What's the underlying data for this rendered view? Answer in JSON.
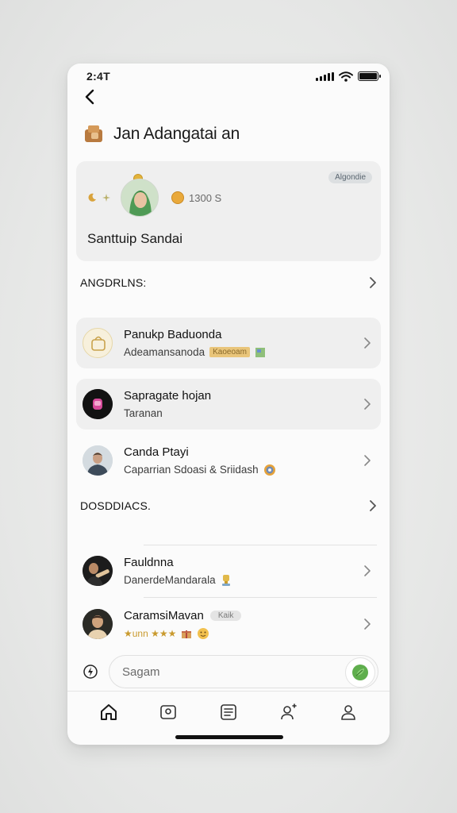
{
  "status_bar": {
    "time": "2:4T"
  },
  "header": {
    "title": "Jan Adangatai an"
  },
  "profile": {
    "badge": "Algondie",
    "coin_text": "1300 S",
    "name": "Santtuip Sandai"
  },
  "sections": [
    {
      "title": "ANGDRLNS:"
    },
    {
      "title": "DOSDDIACS."
    }
  ],
  "list_items": [
    {
      "title": "Panukp Baduonda",
      "subtitle": "Adeamansanoda",
      "tag": "Kaoeoam"
    },
    {
      "title": "Sapragate hojan",
      "subtitle": "Taranan"
    },
    {
      "title": "Canda Ptayi",
      "subtitle": "Caparrian Sdoasi & Sriidash"
    },
    {
      "title": "Fauldnna",
      "subtitle": "DanerdeMandarala"
    },
    {
      "title": "CaramsiMavan",
      "subtitle": "★unn ★★★",
      "tag": "Kaik"
    }
  ],
  "search": {
    "placeholder": "Sagam"
  },
  "tabs": [
    "home",
    "media",
    "list",
    "contacts",
    "profile"
  ]
}
